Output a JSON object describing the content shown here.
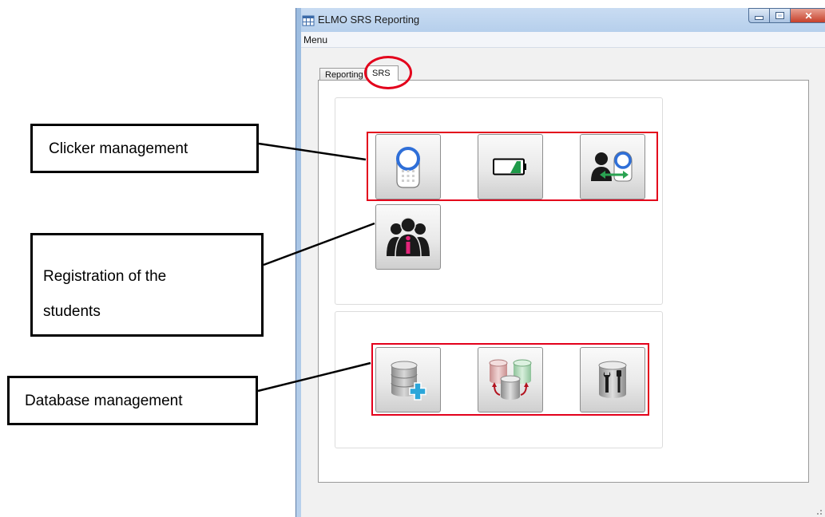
{
  "window": {
    "title": "ELMO SRS Reporting",
    "controls": [
      "minimize",
      "maximize",
      "close"
    ]
  },
  "menu": {
    "items": [
      "Menu"
    ]
  },
  "tabs": [
    {
      "label": "Reporting",
      "selected": false
    },
    {
      "label": "SRS",
      "selected": true
    }
  ],
  "srs": {
    "clicker_buttons": [
      {
        "icon": "clicker-remote-icon"
      },
      {
        "icon": "battery-icon"
      },
      {
        "icon": "assign-clicker-icon"
      }
    ],
    "student_buttons": [
      {
        "icon": "student-info-icon"
      }
    ],
    "database_buttons": [
      {
        "icon": "database-add-icon"
      },
      {
        "icon": "database-switch-icon"
      },
      {
        "icon": "database-tools-icon"
      }
    ]
  },
  "callouts": {
    "clicker": "Clicker management",
    "students_line1": "Registration of the",
    "students_line2": "students",
    "database": "Database management"
  },
  "colors": {
    "highlight": "#e3001b",
    "accent_blue": "#2f6fd8",
    "accent_green": "#2aa352",
    "accent_pink": "#e4257a"
  }
}
